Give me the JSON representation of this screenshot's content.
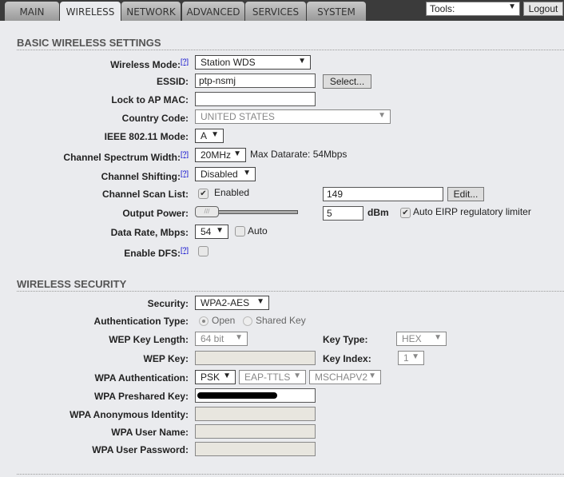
{
  "tabs": [
    "MAIN",
    "WIRELESS",
    "NETWORK",
    "ADVANCED",
    "SERVICES",
    "SYSTEM"
  ],
  "active_tab": "WIRELESS",
  "tools": "Tools:",
  "logout": "Logout",
  "help": "[?]",
  "basic": {
    "title": "BASIC WIRELESS SETTINGS",
    "wireless_mode_label": "Wireless Mode:",
    "wireless_mode": "Station WDS",
    "essid_label": "ESSID:",
    "essid": "ptp-nsmj",
    "select_btn": "Select...",
    "lock_label": "Lock to AP MAC:",
    "lock": "",
    "country_label": "Country Code:",
    "country": "UNITED STATES",
    "ieee_label": "IEEE 802.11 Mode:",
    "ieee": "A",
    "spectrum_label": "Channel Spectrum Width:",
    "spectrum": "20MHz",
    "max_datarate": "Max Datarate: 54Mbps",
    "shifting_label": "Channel Shifting:",
    "shifting": "Disabled",
    "scan_label": "Channel Scan List:",
    "scan_enabled": "Enabled",
    "scan_list": "149",
    "edit_btn": "Edit...",
    "power_label": "Output Power:",
    "power": "5",
    "power_unit": "dBm",
    "eirp": "Auto EIRP regulatory limiter",
    "rate_label": "Data Rate, Mbps:",
    "rate": "54",
    "rate_auto": "Auto",
    "dfs_label": "Enable DFS:"
  },
  "security": {
    "title": "WIRELESS SECURITY",
    "security_label": "Security:",
    "security": "WPA2-AES",
    "auth_type_label": "Authentication Type:",
    "open": "Open",
    "shared": "Shared Key",
    "wep_len_label": "WEP Key Length:",
    "wep_len": "64 bit",
    "key_type_label": "Key Type:",
    "key_type": "HEX",
    "wep_key_label": "WEP Key:",
    "key_index_label": "Key Index:",
    "key_index": "1",
    "wpa_auth_label": "WPA Authentication:",
    "wpa_auth": "PSK",
    "eap": "EAP-TTLS",
    "inner": "MSCHAPV2",
    "psk_label": "WPA Preshared Key:",
    "anon_label": "WPA Anonymous Identity:",
    "user_label": "WPA User Name:",
    "pass_label": "WPA User Password:"
  }
}
